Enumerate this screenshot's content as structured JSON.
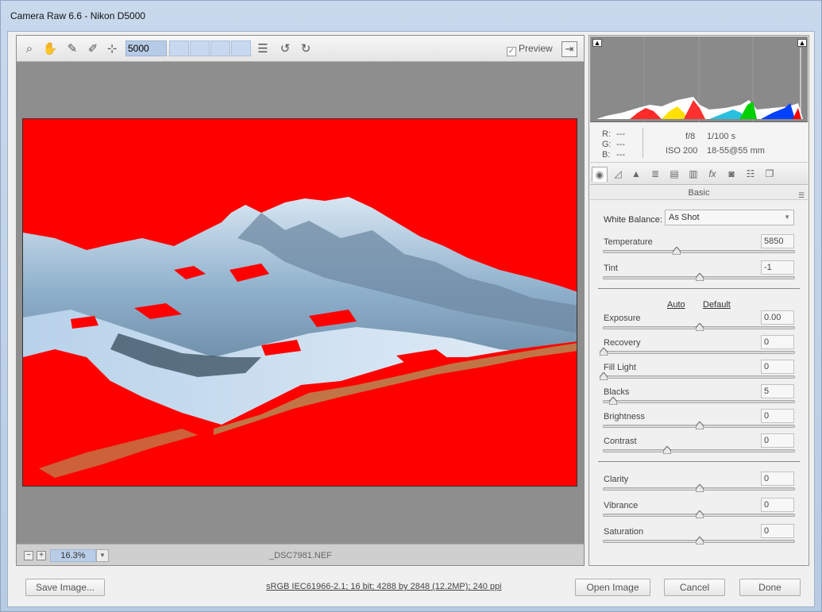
{
  "window": {
    "title": "Camera Raw 6.6  -  Nikon D5000"
  },
  "toolbar": {
    "tools": [
      {
        "icon": "zoom-icon",
        "glyph": "🔍"
      },
      {
        "icon": "hand-icon",
        "glyph": "✋"
      },
      {
        "icon": "eyedropper-icon",
        "glyph": "✎"
      },
      {
        "icon": "color-sampler-icon",
        "glyph": "✐"
      },
      {
        "icon": "target-adjustment-icon",
        "glyph": "⊹"
      }
    ],
    "white_balance_value": "5000",
    "preview_label": "Preview",
    "preview_checked": true
  },
  "viewer": {
    "zoom": "16.3%",
    "filename": "_DSC7981.NEF",
    "clipping_color": "#ff0000"
  },
  "info": {
    "r_label": "R:",
    "r_value": "---",
    "g_label": "G:",
    "g_value": "---",
    "b_label": "B:",
    "b_value": "---",
    "aperture": "f/8",
    "shutter": "1/100 s",
    "iso": "ISO 200",
    "lens": "18-55@55 mm"
  },
  "panel": {
    "section_title": "Basic",
    "white_balance_label": "White Balance:",
    "white_balance_value": "As Shot",
    "auto_label": "Auto",
    "default_label": "Default",
    "sliders": [
      {
        "label": "Temperature",
        "value": "5850",
        "pos": 0.38
      },
      {
        "label": "Tint",
        "value": "-1",
        "pos": 0.5
      },
      {
        "label": "Exposure",
        "value": "0.00",
        "pos": 0.5
      },
      {
        "label": "Recovery",
        "value": "0",
        "pos": 0.0
      },
      {
        "label": "Fill Light",
        "value": "0",
        "pos": 0.0
      },
      {
        "label": "Blacks",
        "value": "5",
        "pos": 0.05
      },
      {
        "label": "Brightness",
        "value": "0",
        "pos": 0.5
      },
      {
        "label": "Contrast",
        "value": "0",
        "pos": 0.33
      },
      {
        "label": "Clarity",
        "value": "0",
        "pos": 0.5
      },
      {
        "label": "Vibrance",
        "value": "0",
        "pos": 0.5
      },
      {
        "label": "Saturation",
        "value": "0",
        "pos": 0.5
      }
    ]
  },
  "footer": {
    "save_label": "Save Image...",
    "file_info": "sRGB IEC61966-2.1; 16 bit; 4288 by 2848 (12.2MP); 240 ppi",
    "open_label": "Open Image",
    "cancel_label": "Cancel",
    "done_label": "Done"
  }
}
